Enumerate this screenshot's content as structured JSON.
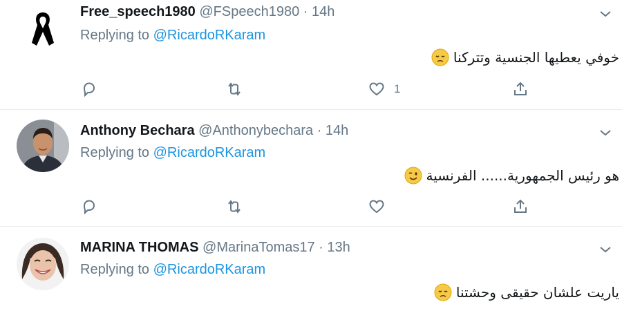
{
  "tweets": [
    {
      "name": "Free_speech1980",
      "handle": "@FSpeech1980",
      "dot": "·",
      "time": "14h",
      "replying_prefix": "Replying to",
      "replying_user": "@RicardoRKaram",
      "text": "خوفي يعطيها الجنسية وتتركنا",
      "emoji": "pensive-face",
      "like_count": "1",
      "avatar": "black-ribbon"
    },
    {
      "name": "Anthony Bechara",
      "handle": "@Anthonybechara",
      "dot": "·",
      "time": "14h",
      "replying_prefix": "Replying to",
      "replying_user": "@RicardoRKaram",
      "text": "هو رئيس الجمهورية...... الفرنسية",
      "emoji": "winking-face",
      "like_count": "",
      "avatar": "profile-photo"
    },
    {
      "name": "MARINA THOMAS",
      "handle": "@MarinaTomas17",
      "dot": "·",
      "time": "13h",
      "replying_prefix": "Replying to",
      "replying_user": "@RicardoRKaram",
      "text": "ياريت علشان حقيقى وحشتنا",
      "emoji": "pensive-face",
      "avatar": "profile-photo"
    }
  ],
  "colors": {
    "link": "#1b95e0",
    "muted": "#657786",
    "text": "#14171a",
    "divider": "#e6ecf0"
  },
  "icons": [
    "chevron-down-icon",
    "reply-icon",
    "retweet-icon",
    "like-icon",
    "share-icon"
  ]
}
